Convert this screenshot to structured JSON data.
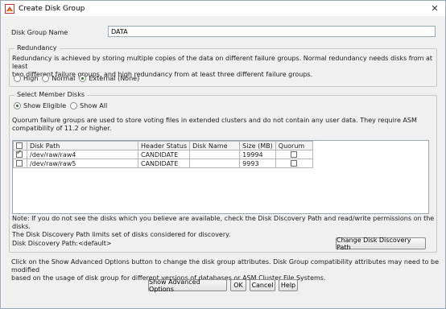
{
  "window": {
    "title": "Create Disk Group",
    "close_glyph": "✕"
  },
  "name_field": {
    "label": "Disk Group Name",
    "value": "DATA"
  },
  "redundancy": {
    "legend": "Redundancy",
    "description_line1": "Redundancy is achieved by storing multiple copies of the data on different failure groups. Normal redundancy needs disks from at least",
    "description_line2": "two different failure groups, and high redundancy from at least three different failure groups.",
    "options": [
      {
        "label": "High",
        "checked": false
      },
      {
        "label": "Normal",
        "checked": false
      },
      {
        "label": "External (None)",
        "checked": true
      }
    ]
  },
  "member_disks": {
    "legend": "Select Member Disks",
    "filter_options": [
      {
        "label": "Show Eligible",
        "checked": true
      },
      {
        "label": "Show All",
        "checked": false
      }
    ],
    "quorum_note_line1": "Quorum failure groups are used to store voting files in extended clusters and do not contain any user data. They require ASM",
    "quorum_note_line2": "compatibility of 11.2 or higher.",
    "columns": [
      "Disk Path",
      "Header Status",
      "Disk Name",
      "Size (MB)",
      "Quorum"
    ],
    "rows": [
      {
        "selected": true,
        "path": "/dev/raw/raw4",
        "header_status": "CANDIDATE",
        "disk_name": "",
        "size_mb": "19994",
        "quorum": false
      },
      {
        "selected": false,
        "path": "/dev/raw/raw5",
        "header_status": "CANDIDATE",
        "disk_name": "",
        "size_mb": "9993",
        "quorum": false
      }
    ],
    "note_line1": "Note: If you do not see the disks which you believe are available, check the Disk Discovery Path and read/write permissions on the disks.",
    "note_line2": "The Disk Discovery Path limits set of disks considered for discovery.",
    "discovery_path_label": "Disk Discovery Path:<default>",
    "change_path_button": "Change Disk Discovery Path"
  },
  "footer": {
    "info_line1": "Click on the Show Advanced Options button to change the disk group attributes. Disk Group compatibility attributes may need to be modified",
    "info_line2": "based on the usage of disk group for different versions of databases or ASM Cluster File Systems.",
    "buttons": {
      "advanced": "Show Advanced Options",
      "ok": "OK",
      "cancel": "Cancel",
      "help": "Help"
    }
  },
  "colors": {
    "accent": "#1b6e1b",
    "border": "#9aa7b8",
    "background": "#f0f0f0"
  },
  "icons": {
    "app": "oracle-installer-icon",
    "close": "close-icon"
  }
}
